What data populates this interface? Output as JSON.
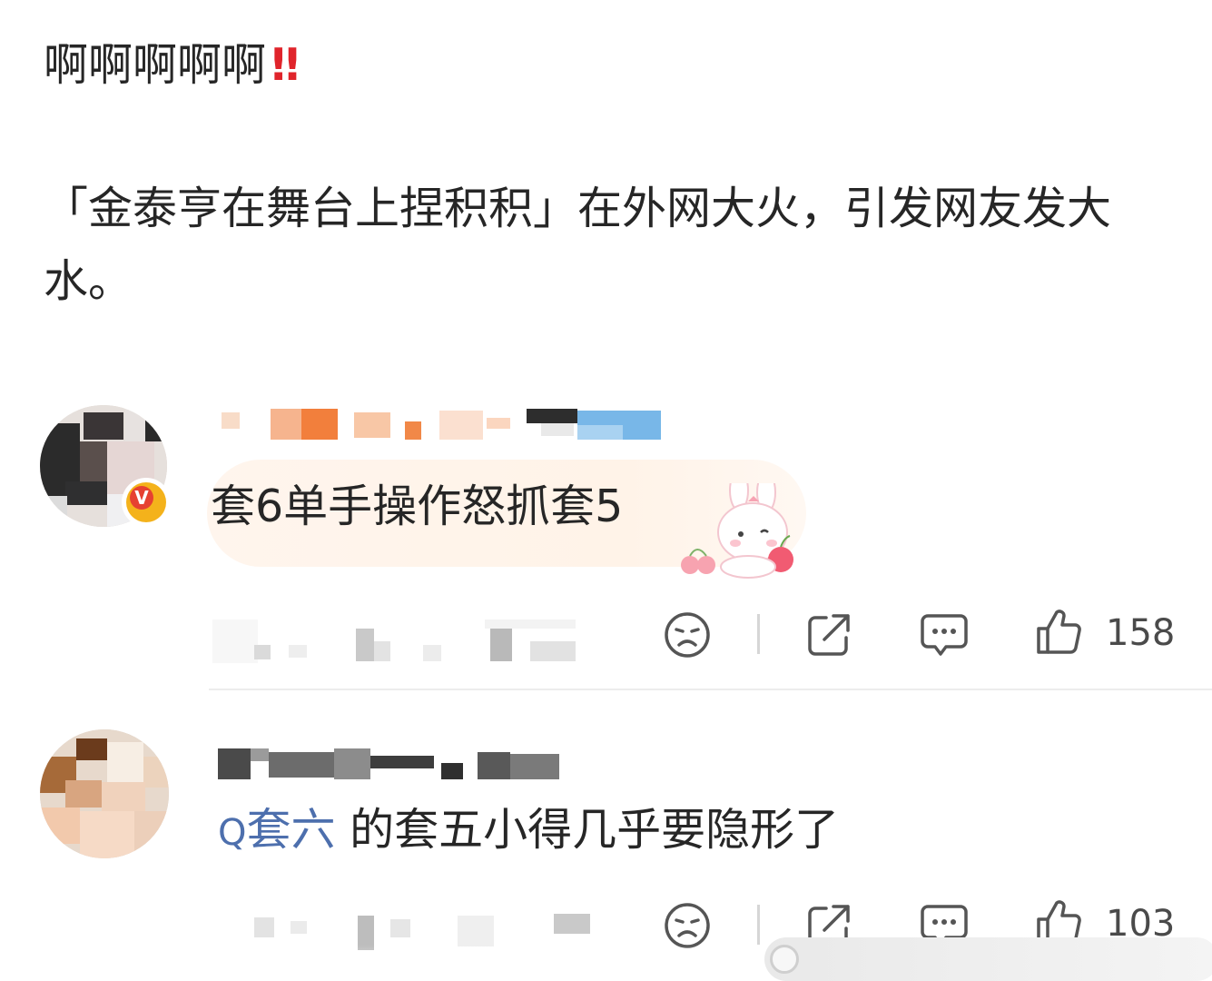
{
  "post": {
    "title": "啊啊啊啊啊",
    "title_emoji": "‼",
    "body": "「金泰亨在舞台上捏积积」在外网大火，引发网友发大水。"
  },
  "comments": [
    {
      "text": "套6单手操作怒抓套5",
      "badge": "V",
      "likes": "158",
      "actions": [
        "dislike-icon",
        "share-icon",
        "comment-icon",
        "like-icon"
      ]
    },
    {
      "topic_icon": "Q",
      "topic": "套六",
      "text": " 的套五小得几乎要隐形了",
      "likes": "103",
      "actions": [
        "dislike-icon",
        "share-icon",
        "comment-icon",
        "like-icon"
      ]
    }
  ],
  "colors": {
    "text": "#262626",
    "topic_link": "#4d6fad",
    "exclaim": "#e0242b",
    "bubble": "#fff4ea",
    "badge_outer": "#f4b21b",
    "badge_inner": "#e64131",
    "icon": "#555555"
  }
}
